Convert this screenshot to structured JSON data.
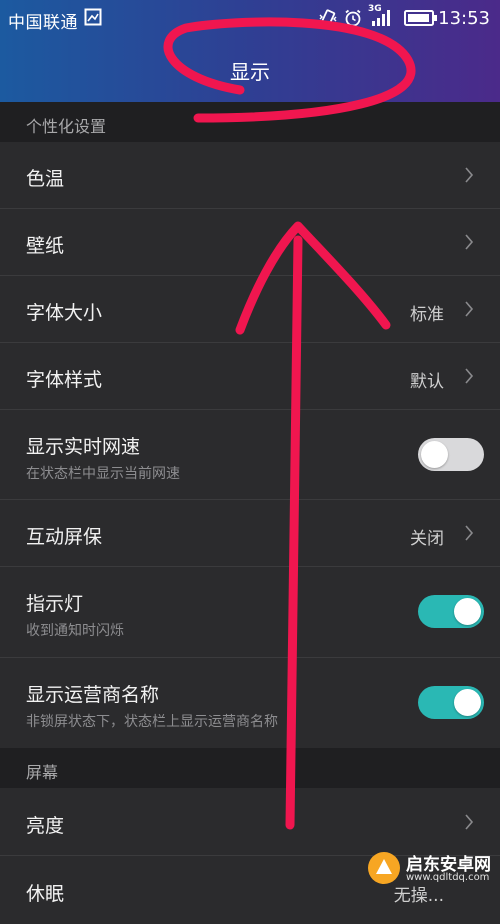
{
  "status_bar": {
    "carrier": "中国联通",
    "network": "3G",
    "time": "13:53"
  },
  "header": {
    "title": "显示"
  },
  "sections": {
    "personalization": "个性化设置",
    "screen": "屏幕"
  },
  "rows": {
    "color_temp": {
      "title": "色温"
    },
    "wallpaper": {
      "title": "壁纸"
    },
    "font_size": {
      "title": "字体大小",
      "value": "标准"
    },
    "font_style": {
      "title": "字体样式",
      "value": "默认"
    },
    "net_speed": {
      "title": "显示实时网速",
      "subtitle": "在状态栏中显示当前网速",
      "enabled": false
    },
    "screensaver": {
      "title": "互动屏保",
      "value": "关闭"
    },
    "indicator": {
      "title": "指示灯",
      "subtitle": "收到通知时闪烁",
      "enabled": true
    },
    "carrier_name": {
      "title": "显示运营商名称",
      "subtitle": "非锁屏状态下，状态栏上显示运营商名称",
      "enabled": true
    },
    "brightness": {
      "title": "亮度"
    },
    "sleep": {
      "title": "休眠",
      "value": "无操..."
    }
  },
  "watermark": {
    "name": "启东安卓网",
    "url": "www.qdltdq.com"
  },
  "colors": {
    "accent_toggle": "#2ab8b4",
    "annotation": "#f0164f",
    "background": "#2b2b2d"
  },
  "icons": [
    "image-icon",
    "vibrate-icon",
    "alarm-icon",
    "signal-icon",
    "battery-icon",
    "chevron-right-icon"
  ]
}
